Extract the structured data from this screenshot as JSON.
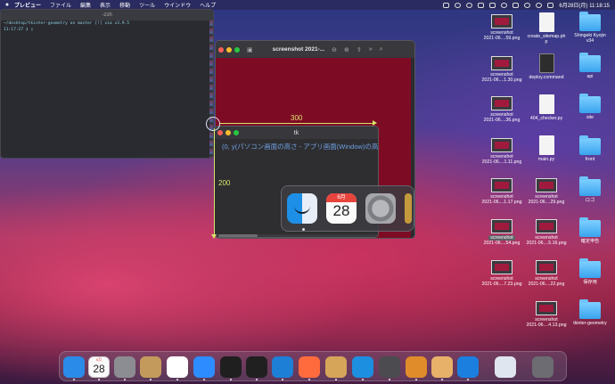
{
  "menubar": {
    "apple": "",
    "items": [
      "プレビュー",
      "ファイル",
      "編集",
      "表示",
      "移動",
      "ツール",
      "ウインドウ",
      "ヘルプ"
    ],
    "clock": "6月28日(月) 11:18:15"
  },
  "terminal": {
    "title": "-zsh",
    "prompt_line": "~/desktop/tkinter-geometry on  master [!] via  v3.9.5",
    "time_line": "11:17:27 ❯ ▯"
  },
  "preview": {
    "title": "screenshot 2021-...",
    "accent_color": "#7e0b24"
  },
  "tk": {
    "title": "tk",
    "coord_text": "(0, y(パソコン画面の高さ - アプリ画面(Window)の高さ))",
    "width_label": "300",
    "height_label": "200"
  },
  "dock_popup": {
    "calendar_month": "6月",
    "calendar_day": "28",
    "icons": [
      "finder-icon",
      "calendar-icon",
      "system-preferences-icon"
    ]
  },
  "desktop": {
    "col1": [
      {
        "l1": "screenshot",
        "l2": "2021-06....59.png"
      },
      {
        "l1": "screenshot",
        "l2": "2021-06....1.30.png"
      },
      {
        "l1": "screenshot",
        "l2": "2021-06....36.png"
      },
      {
        "l1": "screenshot",
        "l2": "2021-06....1.11.png"
      },
      {
        "l1": "screenshot",
        "l2": "2021-06....1.17.png"
      },
      {
        "l1": "screenshot",
        "l2": "2021-06....54.png"
      },
      {
        "l1": "screenshot",
        "l2": "2021-06....7.23.png"
      }
    ],
    "col2": [
      {
        "l1": "create_sitemap.ph",
        "l2": "p"
      },
      {
        "l1": "deploy.command",
        "l2": ""
      },
      {
        "l1": "404_checker.py",
        "l2": ""
      },
      {
        "l1": "main.py",
        "l2": ""
      },
      {
        "l1": "screenshot",
        "l2": "2021-06....29.png"
      },
      {
        "l1": "screenshot",
        "l2": "2021-06....5.16.png"
      },
      {
        "l1": "screenshot",
        "l2": "2021-06....22.png"
      },
      {
        "l1": "screenshot",
        "l2": "2021-06....4.13.png"
      }
    ],
    "col3": [
      {
        "l1": "Shingeki Kyojin",
        "l2": "v34"
      },
      {
        "l1": "api",
        "l2": ""
      },
      {
        "l1": "site",
        "l2": ""
      },
      {
        "l1": "front",
        "l2": ""
      },
      {
        "l1": "ロゴ",
        "l2": ""
      },
      {
        "l1": "確定申告",
        "l2": ""
      },
      {
        "l1": "保存用",
        "l2": ""
      },
      {
        "l1": "tkinter-geometry",
        "l2": ""
      }
    ]
  },
  "dock": {
    "calendar_month": "6月",
    "calendar_day": "28",
    "apps": [
      "finder",
      "calendar",
      "system-preferences",
      "contacts",
      "chrome",
      "zoom",
      "terminal-iterm",
      "terminal",
      "vscode",
      "git-app",
      "keychain",
      "docker",
      "quicktime",
      "sourcetree",
      "preview",
      "infinity",
      "screenshot",
      "trash"
    ]
  }
}
